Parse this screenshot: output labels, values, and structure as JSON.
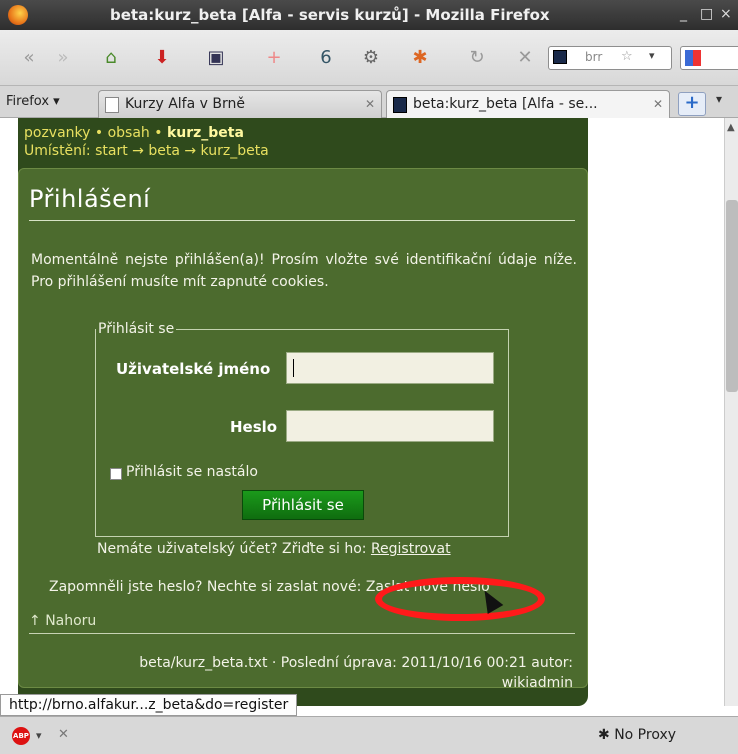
{
  "window": {
    "title": "beta:kurz_beta [Alfa - servis kurzů] - Mozilla Firefox",
    "min": "_",
    "max": "□",
    "close": "×"
  },
  "toolbar": {
    "url_text": "brr"
  },
  "tabs": {
    "menu_label": "Firefox",
    "items": [
      {
        "label": "Kurzy Alfa v Brně"
      },
      {
        "label": "beta:kurz_beta [Alfa - se...",
        "active": true
      }
    ]
  },
  "page": {
    "breadcrumbs_trail": "pozvanky • obsah •",
    "breadcrumbs_current": "kurz_beta",
    "location": "Umístění: start → beta → kurz_beta",
    "heading": "Přihlášení",
    "intro": "Momentálně nejste přihlášen(a)! Prosím vložte své identifikační údaje níže. Pro přihlášení musíte mít zapnuté cookies.",
    "login": {
      "legend": "Přihlásit se",
      "username_label": "Uživatelské jméno",
      "password_label": "Heslo",
      "remember_label": "Přihlásit se nastálo",
      "submit_label": "Přihlásit se"
    },
    "register_text": "Nemáte uživatelský účet? Zřiďte si ho:",
    "register_link": "Registrovat",
    "forgot_text": "Zapomněli jste heslo? Nechte si zaslat nové:",
    "forgot_link": "Zaslat nové heslo",
    "top_link": "Nahoru",
    "footer_line1": "beta/kurz_beta.txt · Poslední úprava: 2011/10/16 00:21 autor:",
    "footer_line2": "wikiadmin"
  },
  "status": {
    "link_preview": "http://brno.alfakur...z_beta&do=register",
    "proxy": "No Proxy"
  },
  "colors": {
    "annotation": "#ff1a1a",
    "page_bg": "#4c6b2e",
    "button": "#1b9a1b"
  }
}
